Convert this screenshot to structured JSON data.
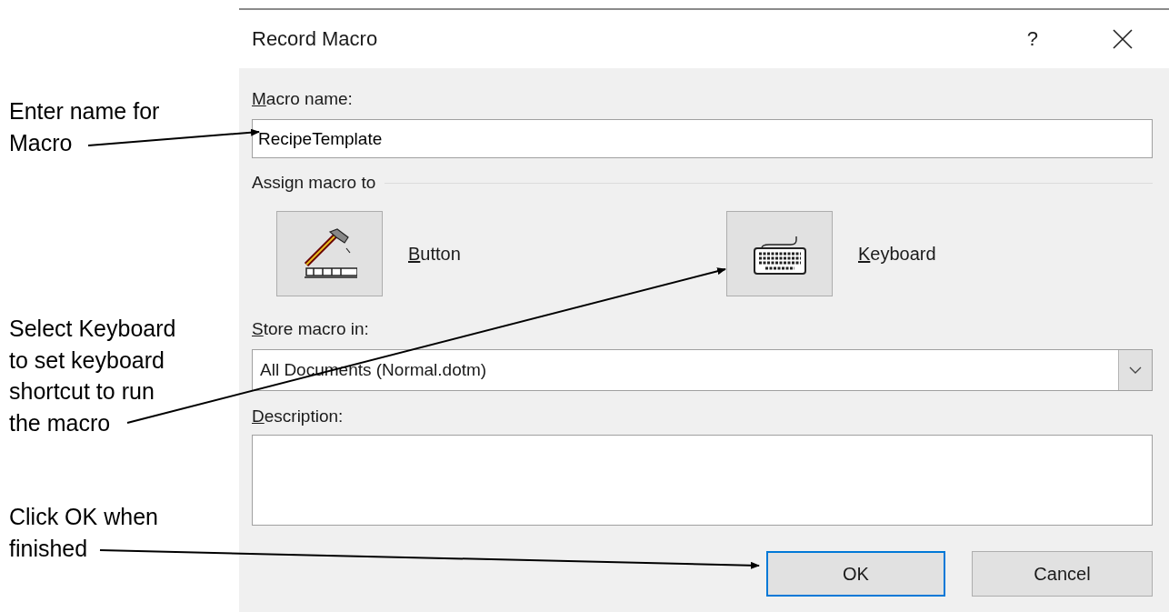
{
  "window": {
    "title": "Record Macro",
    "help": "?"
  },
  "macro_name": {
    "label": "Macro name:",
    "value": "RecipeTemplate"
  },
  "assign": {
    "heading": "Assign macro to",
    "options": [
      {
        "label": "Button",
        "kind": "button"
      },
      {
        "label": "Keyboard",
        "kind": "keyboard"
      }
    ]
  },
  "store": {
    "label": "Store macro in:",
    "value": "All Documents (Normal.dotm)"
  },
  "description": {
    "label": "Description:"
  },
  "buttons": [
    {
      "label": "OK",
      "default": true
    },
    {
      "label": "Cancel",
      "default": false
    }
  ],
  "annotations": [
    {
      "text": "Enter name for\nMacro"
    },
    {
      "text": "Select Keyboard\nto set keyboard\nshortcut to run\nthe macro"
    },
    {
      "text": "Click OK when\nfinished"
    }
  ]
}
